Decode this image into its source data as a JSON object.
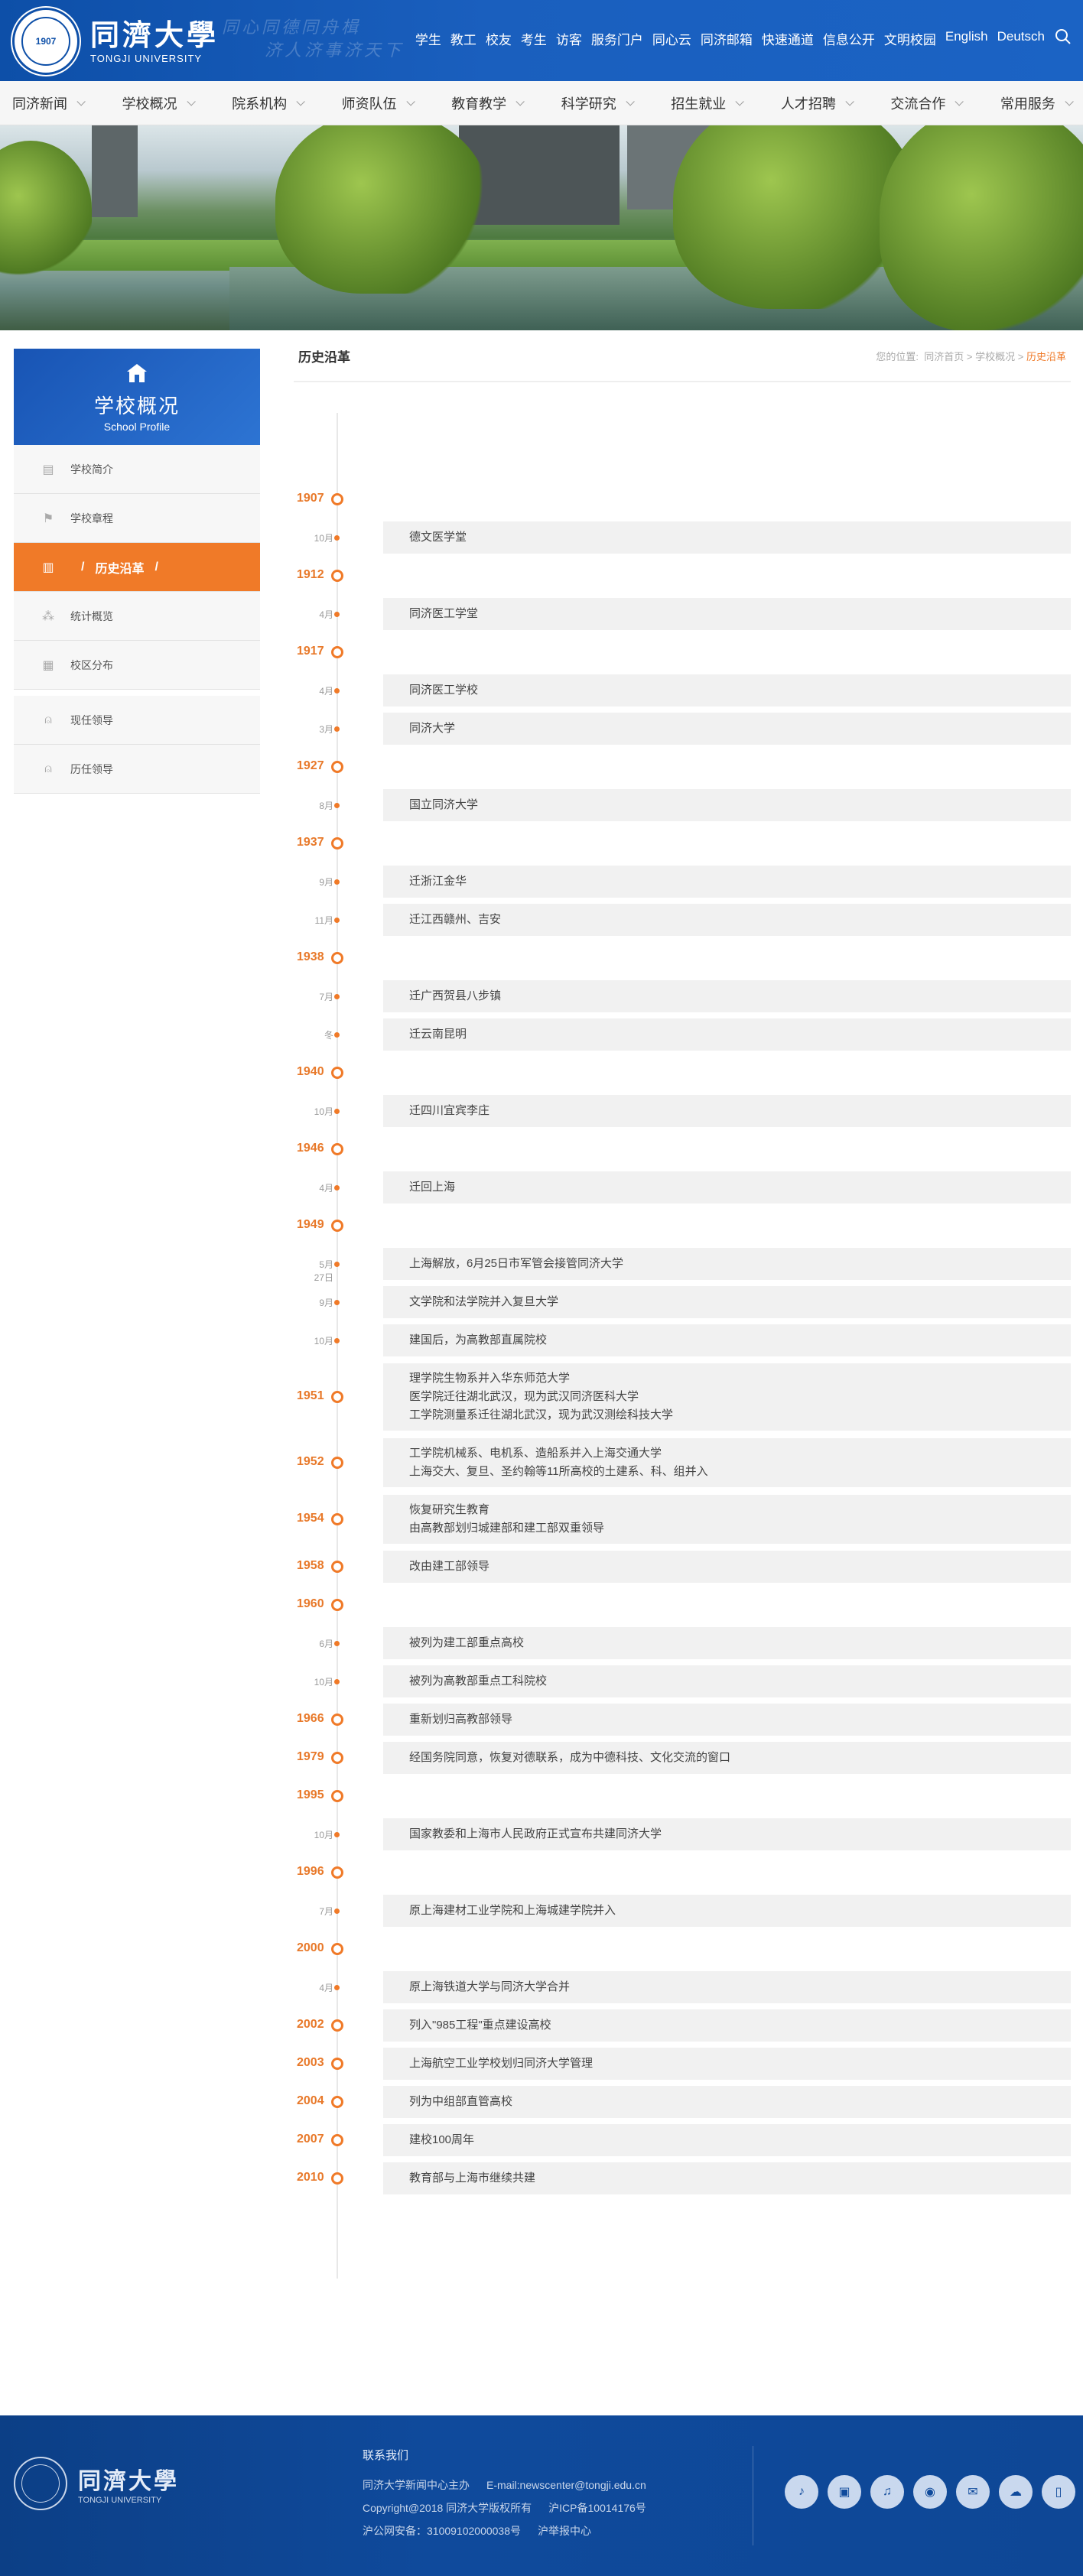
{
  "header": {
    "logo_cn": "同濟大學",
    "logo_en": "TONGJI UNIVERSITY",
    "seal_text": "1907",
    "watermark_line1": "同心同德同舟楫",
    "watermark_line2": "济人济事济天下",
    "links": [
      "学生",
      "教工",
      "校友",
      "考生",
      "访客",
      "服务门户",
      "同心云",
      "同济邮箱",
      "快速通道",
      "信息公开",
      "文明校园",
      "English",
      "Deutsch"
    ]
  },
  "nav": {
    "items": [
      "同济新闻",
      "学校概况",
      "院系机构",
      "师资队伍",
      "教育教学",
      "科学研究",
      "招生就业",
      "人才招聘",
      "交流合作",
      "常用服务"
    ]
  },
  "sidebar": {
    "title_cn": "学校概况",
    "title_en": "School Profile",
    "items": [
      {
        "label": "学校简介",
        "icon": "document-icon"
      },
      {
        "label": "学校章程",
        "icon": "flag-icon"
      },
      {
        "label": "历史沿革",
        "icon": "bar-chart-icon"
      },
      {
        "label": "统计概览",
        "icon": "sitemap-icon"
      },
      {
        "label": "校区分布",
        "icon": "map-icon"
      },
      {
        "label": "现任领导",
        "icon": "user-icon"
      },
      {
        "label": "历任领导",
        "icon": "user-icon"
      }
    ],
    "active_prefix": "/",
    "active_suffix": "/"
  },
  "content": {
    "title": "历史沿革",
    "breadcrumb": {
      "prefix": "您的位置:",
      "home": "同济首页",
      "sep": ">",
      "parent": "学校概况",
      "current": "历史沿革"
    }
  },
  "timeline": [
    {
      "year": "1907"
    },
    {
      "month": "10月",
      "text": [
        "德文医学堂"
      ]
    },
    {
      "year": "1912"
    },
    {
      "month": "4月",
      "text": [
        "同济医工学堂"
      ]
    },
    {
      "year": "1917"
    },
    {
      "month": "4月",
      "text": [
        "同济医工学校"
      ]
    },
    {
      "month": "3月",
      "text": [
        "同济大学"
      ]
    },
    {
      "year": "1927"
    },
    {
      "month": "8月",
      "text": [
        "国立同济大学"
      ]
    },
    {
      "year": "1937"
    },
    {
      "month": "9月",
      "text": [
        "迁浙江金华"
      ]
    },
    {
      "month": "11月",
      "text": [
        "迁江西赣州、吉安"
      ]
    },
    {
      "year": "1938"
    },
    {
      "month": "7月",
      "text": [
        "迁广西贺县八步镇"
      ]
    },
    {
      "month": "冬",
      "text": [
        "迁云南昆明"
      ]
    },
    {
      "year": "1940"
    },
    {
      "month": "10月",
      "text": [
        "迁四川宜宾李庄"
      ]
    },
    {
      "year": "1946"
    },
    {
      "month": "4月",
      "text": [
        "迁回上海"
      ]
    },
    {
      "year": "1949"
    },
    {
      "month": "5月27日",
      "text": [
        "上海解放，6月25日市军管会接管同济大学"
      ]
    },
    {
      "month": "9月",
      "text": [
        "文学院和法学院并入复旦大学"
      ]
    },
    {
      "month": "10月",
      "text": [
        "建国后，为高教部直属院校"
      ]
    },
    {
      "year": "1951",
      "text": [
        "理学院生物系并入华东师范大学",
        "医学院迁往湖北武汉，现为武汉同济医科大学",
        "工学院测量系迁往湖北武汉，现为武汉测绘科技大学"
      ]
    },
    {
      "year": "1952",
      "text": [
        "工学院机械系、电机系、造船系并入上海交通大学",
        "上海交大、复旦、圣约翰等11所高校的土建系、科、组并入"
      ]
    },
    {
      "year": "1954",
      "text": [
        "恢复研究生教育",
        "由高教部划归城建部和建工部双重领导"
      ]
    },
    {
      "year": "1958",
      "text": [
        "改由建工部领导"
      ]
    },
    {
      "year": "1960"
    },
    {
      "month": "6月",
      "text": [
        "被列为建工部重点高校"
      ]
    },
    {
      "month": "10月",
      "text": [
        "被列为高教部重点工科院校"
      ]
    },
    {
      "year": "1966",
      "text": [
        "重新划归高教部领导"
      ]
    },
    {
      "year": "1979",
      "text": [
        "经国务院同意，恢复对德联系，成为中德科技、文化交流的窗口"
      ]
    },
    {
      "year": "1995"
    },
    {
      "month": "10月",
      "text": [
        "国家教委和上海市人民政府正式宣布共建同济大学"
      ]
    },
    {
      "year": "1996"
    },
    {
      "month": "7月",
      "text": [
        "原上海建材工业学院和上海城建学院并入"
      ]
    },
    {
      "year": "2000"
    },
    {
      "month": "4月",
      "text": [
        "原上海铁道大学与同济大学合并"
      ]
    },
    {
      "year": "2002",
      "text": [
        "列入\"985工程\"重点建设高校"
      ]
    },
    {
      "year": "2003",
      "text": [
        "上海航空工业学校划归同济大学管理"
      ]
    },
    {
      "year": "2004",
      "text": [
        "列为中组部直管高校"
      ]
    },
    {
      "year": "2007",
      "text": [
        "建校100周年"
      ]
    },
    {
      "year": "2010",
      "text": [
        "教育部与上海市继续共建"
      ]
    }
  ],
  "footer": {
    "logo_cn": "同濟大學",
    "logo_en": "TONGJI UNIVERSITY",
    "contact_title": "联系我们",
    "line1a": "同济大学新闻中心主办",
    "line1b": "E-mail:newscenter@tongji.edu.cn",
    "line2a": "Copyright@2018  同济大学版权所有",
    "line2b": "沪ICP备10014176号",
    "line3a": "沪公网安备：31009102000038号",
    "line3b": "沪举报中心",
    "socials": [
      "douyin-icon",
      "bilibili-icon",
      "music-icon",
      "weibo-icon",
      "wechat-icon",
      "cloud-icon",
      "mobile-icon"
    ]
  }
}
